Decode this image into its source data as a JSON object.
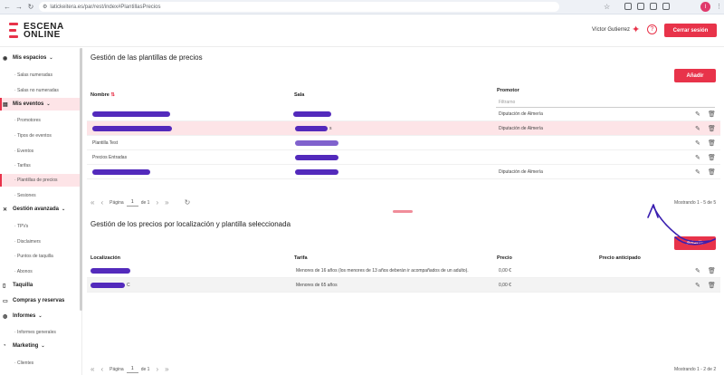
{
  "browser": {
    "url": "latickeitera.es/par/rest/index#PlantillasPrecios",
    "avatar_letter": "I"
  },
  "header": {
    "logo_line1": "ESCENA",
    "logo_line2": "ONLINE",
    "user_name": "Víctor Gutierrez",
    "help_symbol": "?",
    "logout_label": "Cerrar sesión"
  },
  "sidebar": {
    "sections": [
      {
        "label": "Mis espacios",
        "icon": "location-pin-icon",
        "chevron": true
      },
      {
        "label": "Mis eventos",
        "icon": "calendar-icon",
        "chevron": true
      },
      {
        "label": "Gestión avanzada",
        "icon": "tools-icon",
        "chevron": true
      },
      {
        "label": "Taquilla",
        "icon": "document-icon",
        "chevron": false
      },
      {
        "label": "Compras y reservas",
        "icon": "cart-icon",
        "chevron": false
      },
      {
        "label": "Informes",
        "icon": "chart-icon",
        "chevron": true
      },
      {
        "label": "Marketing",
        "icon": "megaphone-icon",
        "chevron": true
      }
    ],
    "subitems": {
      "salas_numeradas": "· Salas numeradas",
      "salas_no_numeradas": "· Salas no numeradas",
      "promotores": "· Promotores",
      "tipos_eventos": "· Tipos de eventos",
      "eventos": "· Eventos",
      "tarifas": "· Tarifas",
      "plantillas_precios": "· Plantillas de precios",
      "sesiones": "· Sesiones",
      "tpvs": "· TPVs",
      "disclaimers": "· Disclaimers",
      "puntos_taquilla": "· Puntos de taquilla",
      "abonos": "· Abonos",
      "informes_generales": "· Informes generales",
      "clientes": "· Clientes"
    }
  },
  "templates": {
    "title": "Gestión de las plantillas de precios",
    "add_label": "Añadir",
    "columns": {
      "name": "Nombre",
      "sort_marker": "⇅",
      "sala": "Sala",
      "promotor": "Promotor"
    },
    "filter_placeholder": "Filtrarno",
    "rows": [
      {
        "name": "",
        "sala": "",
        "promotor": "Diputación de Almería",
        "highlight": false
      },
      {
        "name": "",
        "sala": "s",
        "promotor": "Diputación de Almería",
        "highlight": true
      },
      {
        "name": "Plantilla Test",
        "sala": "",
        "promotor": "",
        "highlight": false
      },
      {
        "name": "Precios Entradas",
        "sala": "",
        "promotor": "",
        "highlight": false
      },
      {
        "name": "",
        "sala": "",
        "promotor": "Diputación de Almería",
        "highlight": false
      }
    ],
    "pager": {
      "page_label": "Página",
      "page": "1",
      "of_label": "de 1"
    },
    "showing": "Mostrando 1 - 5 de 5"
  },
  "prices": {
    "title": "Gestión de los precios por localización y plantilla seleccionada",
    "add_label": "Añadir",
    "columns": {
      "location": "Localización",
      "tarifa": "Tarifa",
      "precio": "Precio",
      "anticipado": "Precio anticipado"
    },
    "rows": [
      {
        "location": "",
        "tarifa": "Menores de 16 años (los menores de 13 años deberán ir acompañados de un adulto).",
        "precio": "0,00 €"
      },
      {
        "location": "C",
        "tarifa": "Menores de 65 años",
        "precio": "0,00 €"
      }
    ],
    "pager": {
      "page_label": "Página",
      "page": "1",
      "of_label": "de 1"
    },
    "showing": "Mostrando 1 - 2 de 2"
  },
  "colors": {
    "accent": "#e8334a",
    "highlight_row": "#fde4e7",
    "redaction": "#4a1fb8"
  }
}
